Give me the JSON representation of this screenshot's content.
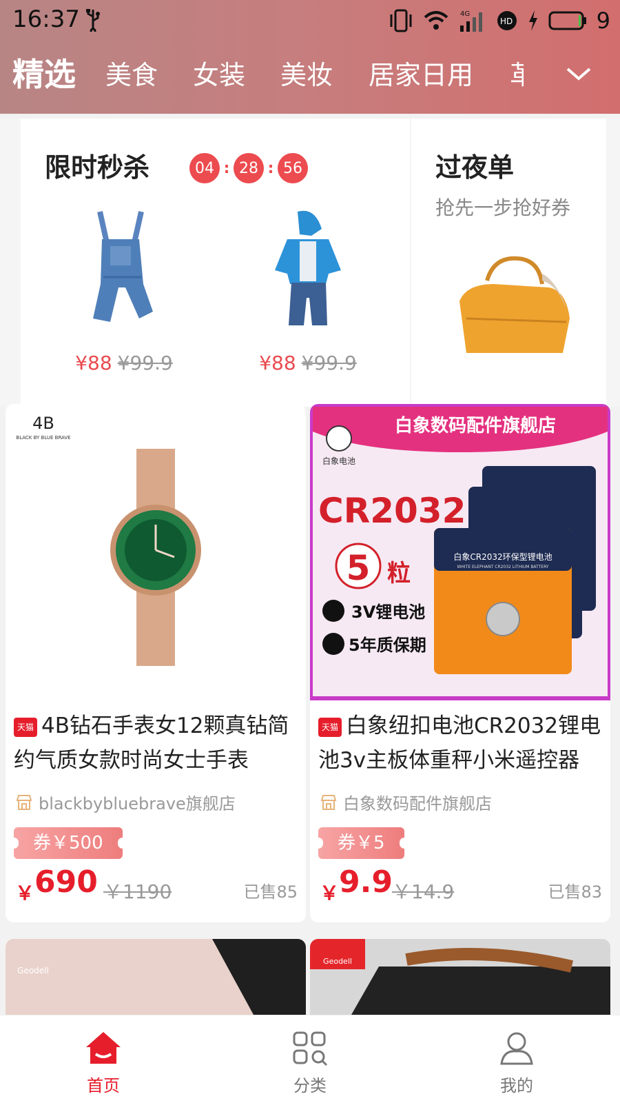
{
  "status_bar": {
    "time": "16:37",
    "battery": "9"
  },
  "tabs": [
    {
      "label": "精选",
      "active": true
    },
    {
      "label": "美食",
      "active": false
    },
    {
      "label": "女装",
      "active": false
    },
    {
      "label": "美妆",
      "active": false
    },
    {
      "label": "居家日用",
      "active": false
    },
    {
      "label": "革",
      "active": false
    }
  ],
  "flash_sale": {
    "title": "限时秒杀",
    "countdown": [
      "04",
      "28",
      "56"
    ],
    "items": [
      {
        "image": "denim-overalls",
        "price": "¥88",
        "original_price": "¥99.9"
      },
      {
        "image": "kids-jacket-outfit",
        "price": "¥88",
        "original_price": "¥99.9"
      }
    ]
  },
  "overnight": {
    "title": "过夜单",
    "subtitle": "抢先一步抢好券",
    "image": "handbag"
  },
  "products": [
    {
      "badge": "天猫",
      "title": "4B钻石手表女12颗真钻简约气质女款时尚女士手表",
      "shop": "blackbybluebrave旗舰店",
      "coupon": "券￥500",
      "yen": "￥",
      "price": "690",
      "original_price": "￥1190",
      "sold": "已售85",
      "brand_logo": "BLACK BY BLUE BRAVE"
    },
    {
      "badge": "天猫",
      "title": "白象纽扣电池CR2032锂电池3v主板体重秤小米遥控器",
      "shop": "白象数码配件旗舰店",
      "coupon": "券￥5",
      "yen": "￥",
      "price": "9.9",
      "original_price": "￥14.9",
      "sold": "已售83",
      "image_text": {
        "store_banner": "白象数码配件旗舰店",
        "brand": "白象电池",
        "model": "CR2032",
        "count": "5",
        "count_unit": "粒",
        "feature1": "3V锂电池",
        "feature2": "5年质保期",
        "pack_label": "白象CR2032环保型锂电池",
        "pack_sub": "WHITE ELEPHANT CR2032 LITHIUM BATTERY"
      }
    }
  ],
  "partial_products": [
    {
      "brand": "Geodell"
    },
    {
      "brand": "Geodell"
    }
  ],
  "bottom_nav": [
    {
      "label": "首页",
      "icon": "home-icon",
      "active": true
    },
    {
      "label": "分类",
      "icon": "category-icon",
      "active": false
    },
    {
      "label": "我的",
      "icon": "profile-icon",
      "active": false
    }
  ],
  "colors": {
    "accent": "#e61e2b",
    "header_start": "#b88585",
    "header_end": "#d26e6e"
  }
}
